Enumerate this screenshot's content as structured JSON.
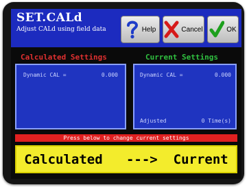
{
  "header": {
    "title": "SET.CALd",
    "subtitle": "Adjust CALd using field data"
  },
  "toolbar": {
    "help_label": "Help",
    "cancel_label": "Cancel",
    "ok_label": "OK",
    "help_icon": "question-mark-icon",
    "cancel_icon": "red-x-icon",
    "ok_icon": "green-checkmark-icon"
  },
  "calculated": {
    "heading": "Calculated Settings",
    "dynamic_cal_label": "Dynamic CAL =",
    "dynamic_cal_value": "0.000"
  },
  "current": {
    "heading": "Current Settings",
    "dynamic_cal_label": "Dynamic CAL =",
    "dynamic_cal_value": "0.000",
    "adjusted_label": "Adjusted",
    "adjusted_value": "0 Time(s)"
  },
  "instruction": "Press below to change current settings",
  "apply_button": {
    "from": "Calculated",
    "arrow": "--->",
    "to": "Current"
  },
  "colors": {
    "header_bg": "#1c2bbf",
    "calculated_heading": "#e03030",
    "current_heading": "#30c040",
    "panel_bg": "#1f34c0",
    "warning_bar": "#e02020",
    "apply_button_bg": "#f3ec2c"
  }
}
